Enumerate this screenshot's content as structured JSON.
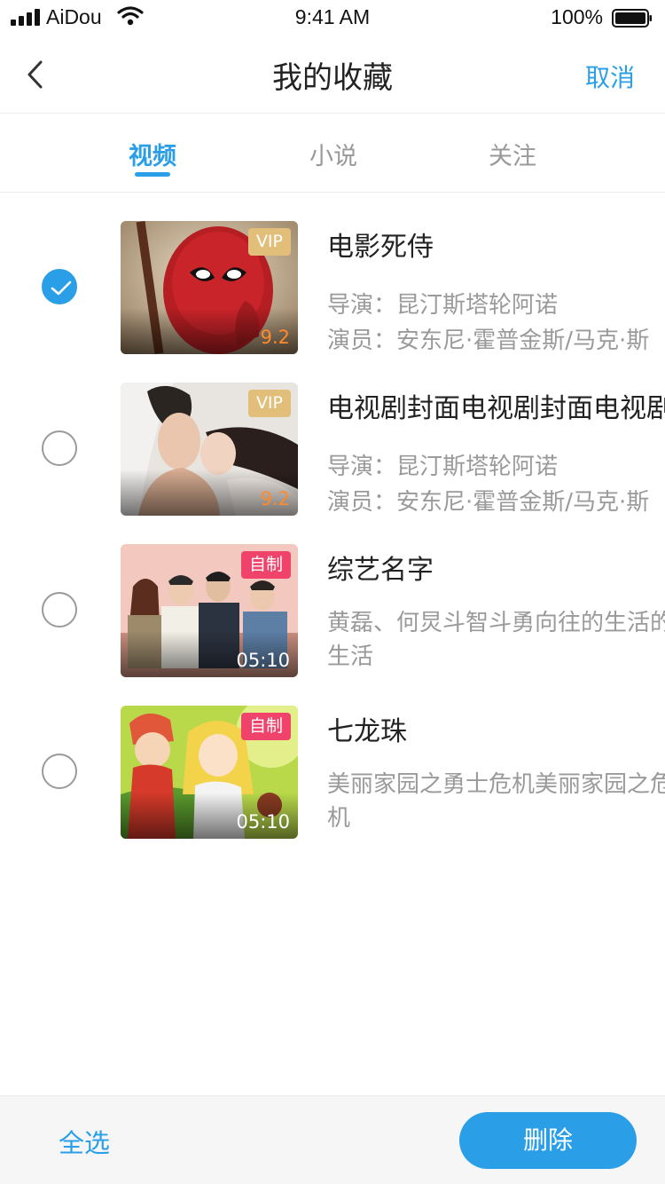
{
  "status_bar": {
    "carrier": "AiDou",
    "time": "9:41 AM",
    "battery": "100%"
  },
  "nav": {
    "title": "我的收藏",
    "cancel_label": "取消"
  },
  "tabs": [
    {
      "label": "视频",
      "active": true
    },
    {
      "label": "小说",
      "active": false
    },
    {
      "label": "关注",
      "active": false
    }
  ],
  "items": [
    {
      "title": "电影死侍",
      "badge": "VIP",
      "corner": "9.2",
      "checked": true,
      "director": "导演：昆汀斯塔轮阿诺",
      "cast": "演员：安东尼·霍普金斯/马克·斯"
    },
    {
      "title": "电视剧封面电视剧封面电视剧",
      "badge": "VIP",
      "corner": "9.2",
      "checked": false,
      "director": "导演：昆汀斯塔轮阿诺",
      "cast": "演员：安东尼·霍普金斯/马克·斯"
    },
    {
      "title": "综艺名字",
      "badge": "自制",
      "corner": "05:10",
      "checked": false,
      "description": "黄磊、何炅斗智斗勇向往的生活的生活"
    },
    {
      "title": "七龙珠",
      "badge": "自制",
      "corner": "05:10",
      "checked": false,
      "description": "美丽家园之勇士危机美丽家园之危机"
    }
  ],
  "footer": {
    "select_all_label": "全选",
    "delete_label": "删除"
  },
  "colors": {
    "accent": "#2a9fe8",
    "vip": "#e1be7a",
    "self_made": "#f0436c",
    "score": "#ff8a2b"
  }
}
